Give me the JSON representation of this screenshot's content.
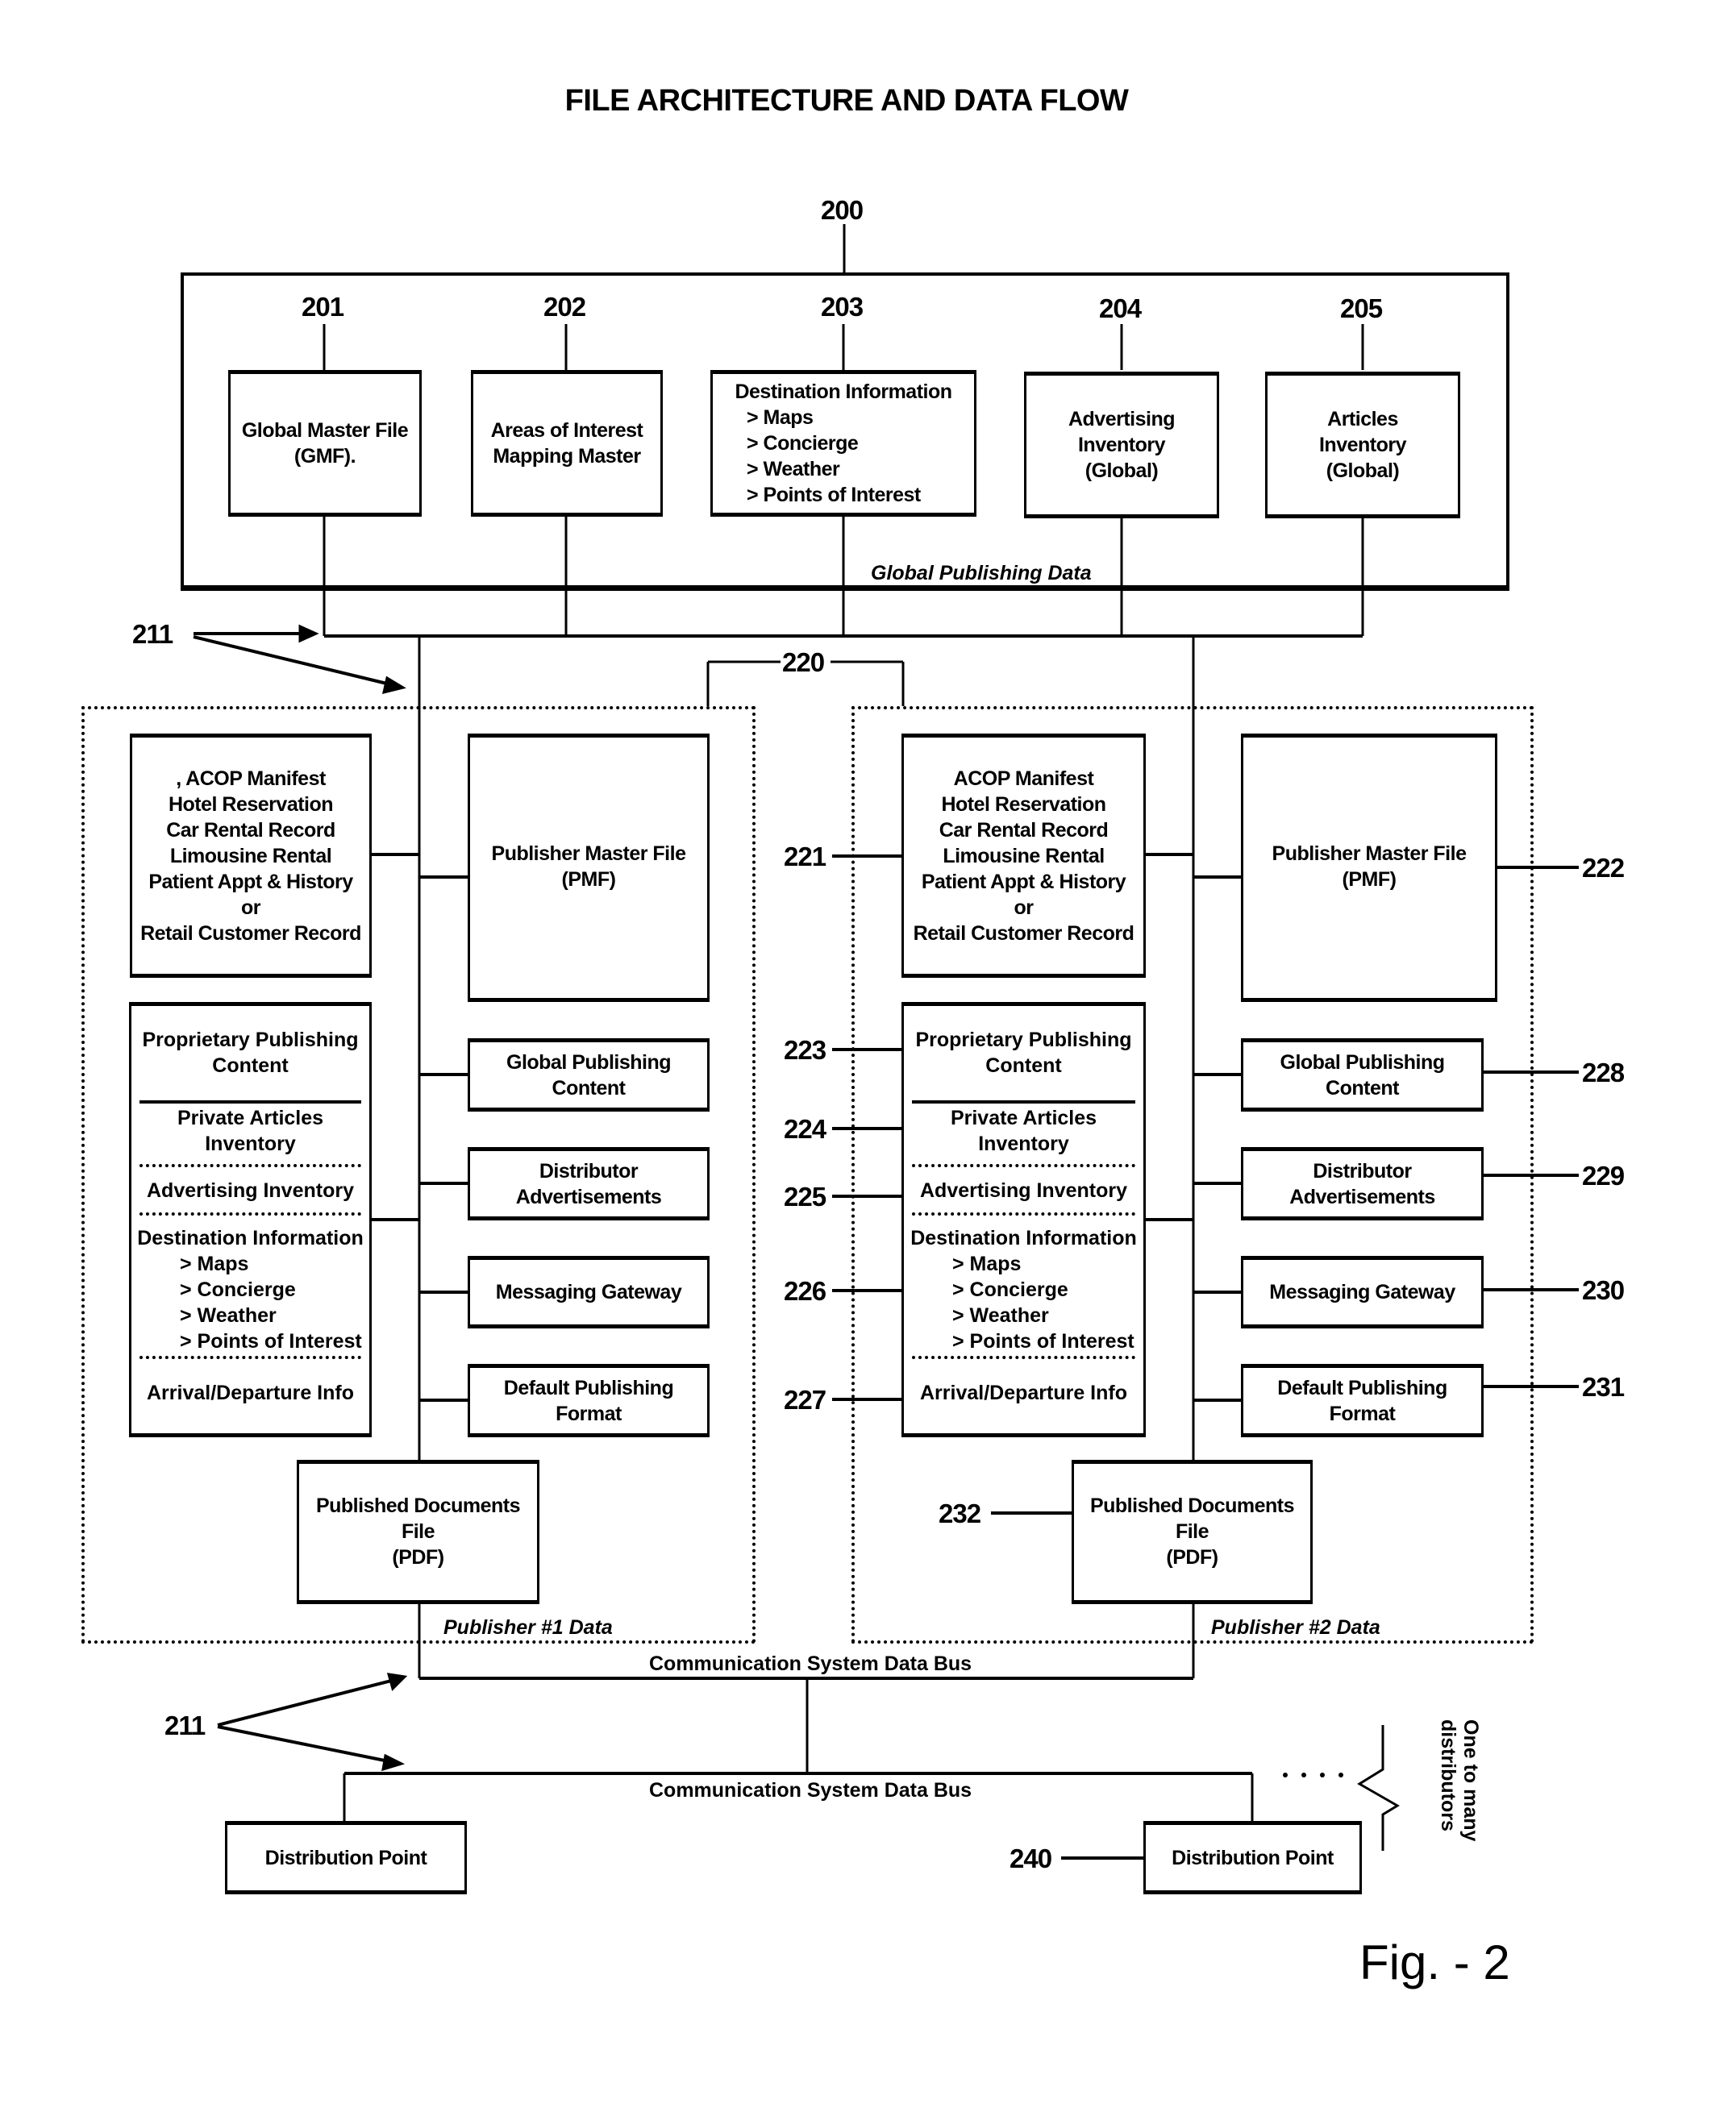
{
  "title": "FILE ARCHITECTURE AND DATA FLOW",
  "figure_label": "Fig. - 2",
  "global": {
    "ref": "200",
    "label": "Global Publishing Data",
    "boxes": [
      {
        "ref": "201",
        "lines": [
          "Global Master File",
          "(GMF)."
        ]
      },
      {
        "ref": "202",
        "lines": [
          "Areas of Interest",
          "Mapping Master"
        ]
      },
      {
        "ref": "203",
        "heading": "Destination Information",
        "items": [
          "> Maps",
          "> Concierge",
          "> Weather",
          "> Points of Interest"
        ]
      },
      {
        "ref": "204",
        "lines": [
          "Advertising",
          "Inventory",
          "(Global)"
        ]
      },
      {
        "ref": "205",
        "lines": [
          "Articles",
          "Inventory",
          "(Global)"
        ]
      }
    ]
  },
  "connectors": {
    "ref_211": "211",
    "ref_220": "220"
  },
  "publishers": [
    {
      "label": "Publisher #1 Data",
      "records": [
        "ACOP Manifest",
        "Hotel Reservation",
        "Car Rental Record",
        "Limousine Rental",
        "Patient Appt & History",
        "or",
        "Retail Customer Record"
      ],
      "records_prefix": ",",
      "pmf": [
        "Publisher Master File",
        "(PMF)"
      ],
      "stack": {
        "proprietary": [
          "Proprietary Publishing",
          "Content"
        ],
        "private_articles": [
          "Private Articles",
          "Inventory"
        ],
        "advertising": "Advertising Inventory",
        "destination_heading": "Destination Information",
        "destination_items": [
          "> Maps",
          "> Concierge",
          "> Weather",
          "> Points of Interest"
        ],
        "arrival": "Arrival/Departure Info"
      },
      "small_boxes": [
        [
          "Global Publishing",
          "Content"
        ],
        [
          "Distributor",
          "Advertisements"
        ],
        [
          "Messaging Gateway"
        ],
        [
          "Default Publishing",
          "Format"
        ]
      ],
      "pdf": [
        "Published Documents",
        "File",
        "(PDF)"
      ]
    },
    {
      "label": "Publisher #2 Data",
      "records": [
        "ACOP Manifest",
        "Hotel Reservation",
        "Car Rental Record",
        "Limousine Rental",
        "Patient Appt & History",
        "or",
        "Retail Customer Record"
      ],
      "pmf": [
        "Publisher Master File",
        "(PMF)"
      ],
      "stack": {
        "proprietary": [
          "Proprietary Publishing",
          "Content"
        ],
        "private_articles": [
          "Private Articles",
          "Inventory"
        ],
        "advertising": "Advertising Inventory",
        "destination_heading": "Destination Information",
        "destination_items": [
          "> Maps",
          "> Concierge",
          "> Weather",
          "> Points of Interest"
        ],
        "arrival": "Arrival/Departure Info"
      },
      "small_boxes": [
        [
          "Global Publishing",
          "Content"
        ],
        [
          "Distributor",
          "Advertisements"
        ],
        [
          "Messaging Gateway"
        ],
        [
          "Default Publishing",
          "Format"
        ]
      ],
      "pdf": [
        "Published Documents",
        "File",
        "(PDF)"
      ],
      "refs": {
        "records": "221",
        "pmf": "222",
        "proprietary": "223",
        "private_articles": "224",
        "advertising": "225",
        "destination": "226",
        "arrival": "227",
        "global_content": "228",
        "distributor_ads": "229",
        "messaging": "230",
        "default_format": "231",
        "pdf": "232"
      }
    }
  ],
  "bus": {
    "upper_label": "Communication System Data Bus",
    "lower_label": "Communication System Data Bus"
  },
  "distribution": {
    "points": [
      "Distribution Point",
      "Distribution Point"
    ],
    "ref": "240",
    "ellipsis": ". . . .",
    "bracket_label": [
      "One to many",
      "distributors"
    ]
  }
}
